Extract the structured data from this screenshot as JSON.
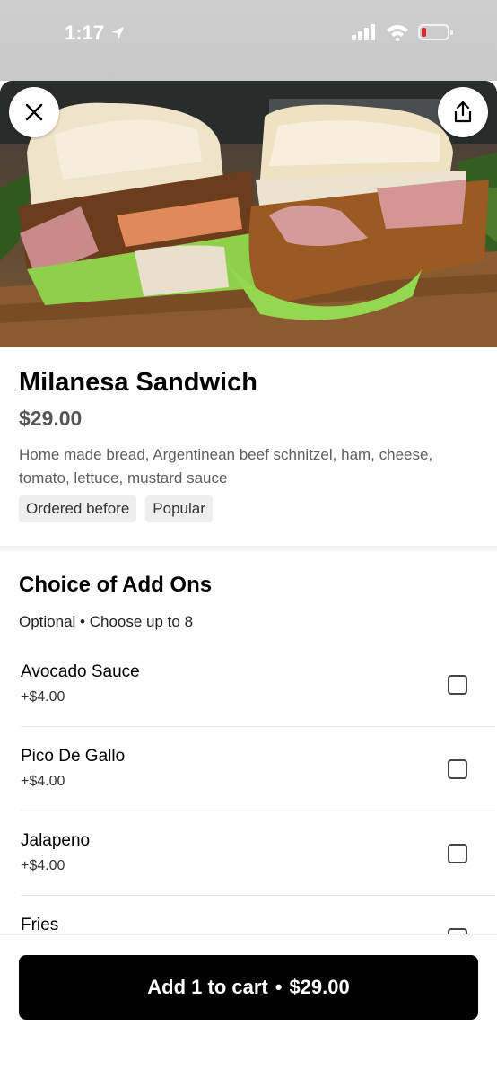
{
  "status_bar": {
    "time": "1:17"
  },
  "item": {
    "title": "Milanesa Sandwich",
    "price": "$29.00",
    "description": "Home made bread, Argentinean beef schnitzel, ham, cheese, tomato, lettuce, mustard sauce",
    "tags": [
      "Ordered before",
      "Popular"
    ]
  },
  "addons": {
    "title": "Choice of Add Ons",
    "subtitle": "Optional • Choose up to 8",
    "options": [
      {
        "name": "Avocado Sauce",
        "price": "+$4.00"
      },
      {
        "name": "Pico De Gallo",
        "price": "+$4.00"
      },
      {
        "name": "Jalapeno",
        "price": "+$4.00"
      },
      {
        "name": "Fries",
        "price": ""
      }
    ]
  },
  "cart": {
    "label": "Add 1 to cart",
    "separator": "•",
    "price": "$29.00"
  }
}
